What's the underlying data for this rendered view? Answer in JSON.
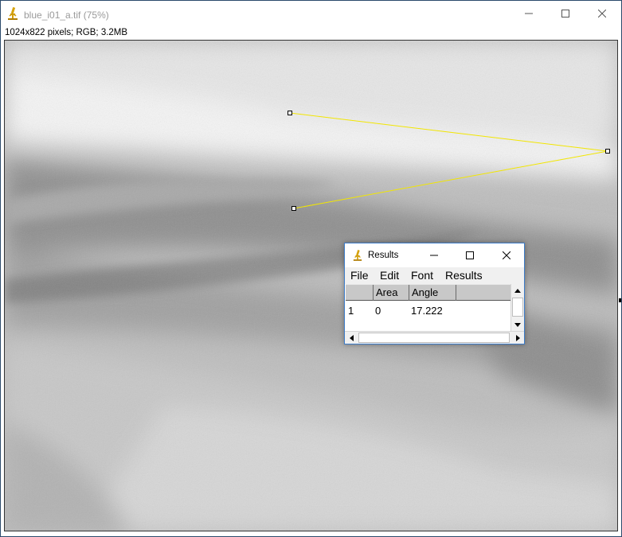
{
  "window": {
    "title": "blue_i01_a.tif (75%)",
    "status": "1024x822 pixels; RGB; 3.2MB",
    "controls": {
      "minimize_icon": "minimize-icon",
      "maximize_icon": "maximize-icon",
      "close_icon": "close-icon"
    }
  },
  "canvas": {
    "image": "grayscale-micrograph",
    "selection_color": "#f2e600",
    "selection_type": "angle"
  },
  "results_window": {
    "title": "Results",
    "menu": [
      "File",
      "Edit",
      "Font",
      "Results"
    ],
    "columns": [
      "",
      "Area",
      "Angle",
      ""
    ],
    "rows": [
      {
        "index": "1",
        "area": "0",
        "angle": "17.222"
      }
    ]
  },
  "colors": {
    "accent_border": "#3d7cc9",
    "table_header": "#c8c8c8",
    "desktop": "#0d1b2a"
  }
}
